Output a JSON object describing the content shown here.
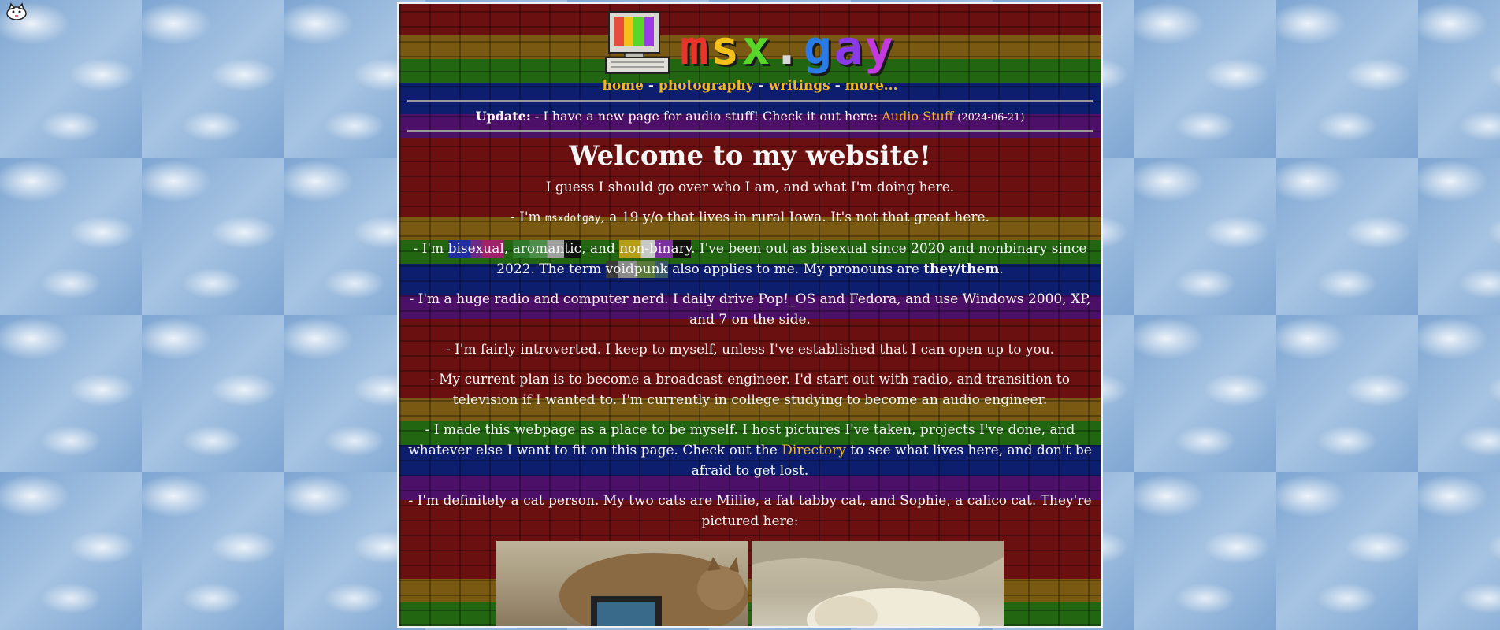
{
  "logo": {
    "letters": [
      "m",
      "s",
      "x",
      ".",
      "g",
      "a",
      "y"
    ],
    "colors": [
      "#e8342a",
      "#f2c21a",
      "#58d62a",
      "#d8d8d8",
      "#2a7ae8",
      "#8a3ae8",
      "#c43ae0"
    ]
  },
  "nav": {
    "home": "home",
    "photography": "photography",
    "writings": "writings",
    "more": "more...",
    "separator": "-"
  },
  "update": {
    "label": "Update:",
    "text": " - I have a new page for audio stuff! Check it out here: ",
    "link": "Audio Stuff",
    "date": "(2024-06-21)"
  },
  "welcome": "Welcome to my website!",
  "intro": "I guess I should go over who I am, and what I'm doing here.",
  "p1": {
    "pre": "- I'm ",
    "username": "msxdotgay",
    "post": ", a 19 y/o that lives in rural Iowa. It's not that great here."
  },
  "p2": {
    "pre": "- I'm ",
    "bisexual": "bisexual",
    "comma1": ", ",
    "aromantic": "aromantic",
    "and": ", and ",
    "nonbinary": "non-binary",
    "mid": ". I've been out as bisexual since 2020 and nonbinary since 2022. The term ",
    "voidpunk": "voidpunk",
    "post": " also applies to me. My pronouns are ",
    "pronouns": "they/them",
    "end": "."
  },
  "p3": "- I'm a huge radio and computer nerd. I daily drive Pop!_OS and Fedora, and use Windows 2000, XP, and 7 on the side.",
  "p4": "- I'm fairly introverted. I keep to myself, unless I've established that I can open up to you.",
  "p5": "- My current plan is to become a broadcast engineer. I'd start out with radio, and transition to television if I wanted to. I'm currently in college studying to become an audio engineer.",
  "p6": {
    "pre": "- I made this webpage as a place to be myself. I host pictures I've taken, projects I've done, and whatever else I want to fit on this page. Check out the ",
    "link": "Directory",
    "post": " to see what lives here, and don't be afraid to get lost."
  },
  "p7": "- I'm definitely a cat person. My two cats are Millie, a fat tabby cat, and Sophie, a calico cat. They're pictured here:"
}
